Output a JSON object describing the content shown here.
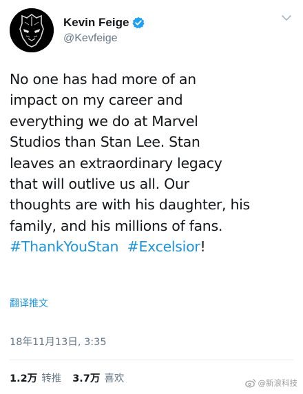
{
  "author": {
    "display_name": "Kevin Feige",
    "handle": "@Kevfeige",
    "verified": true,
    "avatar_icon": "black-panther-mask-icon"
  },
  "menu": {
    "icon": "chevron-down-icon"
  },
  "tweet": {
    "lines": [
      "No one has had more of an",
      "impact on my career and",
      "everything we do at Marvel",
      "Studios than Stan Lee. Stan",
      "leaves an extraordinary legacy",
      "that will outlive us all. Our",
      "thoughts are with his daughter, his",
      "family, and his millions of fans."
    ],
    "hashtag_1": "#ThankYouStan",
    "hashtag_2": "#Excelsior",
    "trailing": "!"
  },
  "translate_label": "翻译推文",
  "timestamp": "18年11月13日, 3:35",
  "stats": {
    "retweets_value": "1.2万",
    "retweets_label": "转推",
    "likes_value": "3.7万",
    "likes_label": "喜欢"
  },
  "watermark": {
    "text": "@新浪科技",
    "icon": "weibo-icon"
  },
  "colors": {
    "link": "#1b95e0",
    "verified": "#1da1f2",
    "secondary_text": "#657786",
    "primary_text": "#14171a"
  }
}
